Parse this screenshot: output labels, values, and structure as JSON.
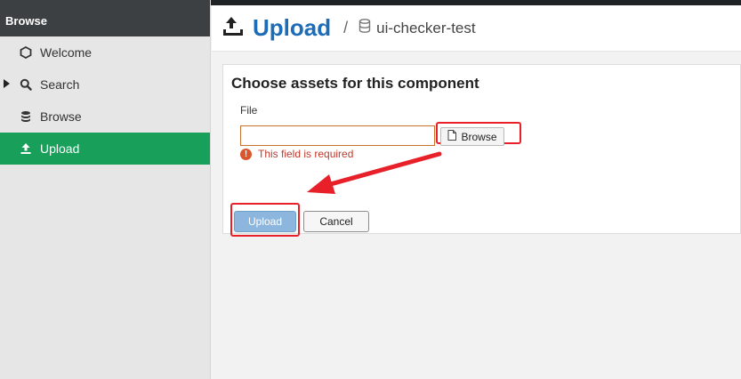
{
  "sidebar": {
    "header": "Browse",
    "items": [
      {
        "label": "Welcome",
        "icon": "hexagon-icon",
        "active": false
      },
      {
        "label": "Search",
        "icon": "search-icon",
        "active": false
      },
      {
        "label": "Browse",
        "icon": "database-icon",
        "active": false
      },
      {
        "label": "Upload",
        "icon": "upload-icon",
        "active": true
      }
    ]
  },
  "header": {
    "title": "Upload",
    "separator": "/",
    "repository": "ui-checker-test"
  },
  "form": {
    "title": "Choose assets for this component",
    "file_label": "File",
    "file_value": "",
    "browse_label": "Browse",
    "error_text": "This field is required",
    "upload_label": "Upload",
    "cancel_label": "Cancel"
  },
  "colors": {
    "accent_green": "#18a05a",
    "title_blue": "#1d6cb7",
    "error_red": "#c0392b",
    "highlight_red": "#e8202a"
  }
}
